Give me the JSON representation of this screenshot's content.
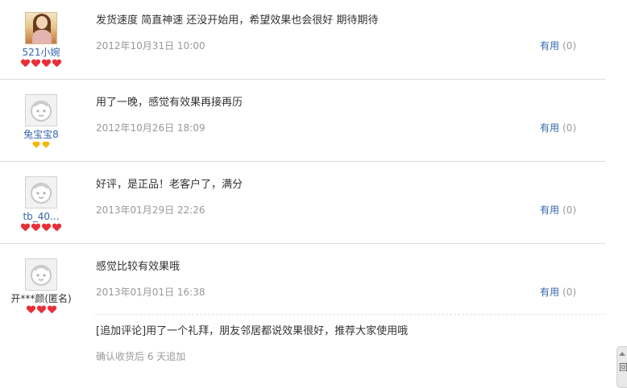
{
  "reviews": [
    {
      "username": "521小婉",
      "avatar_type": "photo",
      "badge_type": "heart",
      "badge_count": 4,
      "content": "发货速度 简直神速 还没开始用，希望效果也会很好 期待期待",
      "date": "2012年10月31日 10:00",
      "useful_label": "有用",
      "useful_count": "(0)"
    },
    {
      "username": "兔宝宝8",
      "avatar_type": "default",
      "badge_type": "diamond",
      "badge_count": 2,
      "content": "用了一晚，感觉有效果再接再历",
      "date": "2012年10月26日 18:09",
      "useful_label": "有用",
      "useful_count": "(0)"
    },
    {
      "username": "tb_40...",
      "avatar_type": "default",
      "badge_type": "heart",
      "badge_count": 4,
      "content": "好评，是正品！老客户了，满分",
      "date": "2013年01月29日 22:26",
      "useful_label": "有用",
      "useful_count": "(0)"
    },
    {
      "username": "开***颜(匿名)",
      "avatar_type": "default",
      "badge_type": "heart",
      "badge_count": 3,
      "content": "感觉比较有效果哦",
      "date": "2013年01月01日 16:38",
      "useful_label": "有用",
      "useful_count": "(0)",
      "append": {
        "content": "[追加评论]用了一个礼拜，朋友邻居都说效果很好，推荐大家使用哦",
        "note": "确认收货后 6 天追加"
      }
    }
  ],
  "side_tab": {
    "label": "回"
  },
  "colors": {
    "link": "#3366aa",
    "text": "#333333",
    "muted": "#999999",
    "divider": "#dddddd",
    "heart_badge": "#e8303a",
    "diamond_badge": "#f2b90a"
  }
}
